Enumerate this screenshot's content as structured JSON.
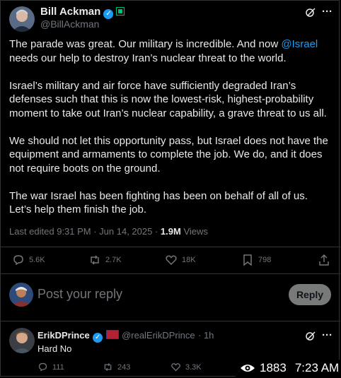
{
  "post": {
    "author_name": "Bill Ackman",
    "author_handle": "@BillAckman",
    "paragraphs": [
      {
        "before": "The parade was great. Our military is incredible. And now ",
        "mention": "@Israel",
        "after": " needs our help to destroy Iran’s nuclear threat to the world."
      },
      {
        "text": "Israel’s military and air force have sufficiently degraded Iran’s defenses such that this is now the lowest-risk, highest-probability moment to take out Iran’s nuclear capability, a grave threat to us all."
      },
      {
        "text": "We should not let this opportunity pass, but Israel does not have the equipment and armaments to complete the job. We do, and it does not require boots on the ground."
      },
      {
        "text": "The war Israel has been fighting has been on behalf of all of us. Let’s help them finish the job."
      }
    ],
    "meta_edited": "Last edited 9:31 PM · Jun 14, 2025 · ",
    "views_count": "1.9M",
    "views_label": " Views",
    "actions": {
      "replies": "5.6K",
      "reposts": "2.7K",
      "likes": "18K",
      "bookmarks": "798"
    }
  },
  "composer": {
    "placeholder": "Post your reply",
    "reply_button": "Reply"
  },
  "reply": {
    "author_name": "ErikDPrince",
    "author_handle": "@realErikDPrince",
    "time": "· 1h",
    "text": "Hard No",
    "actions": {
      "replies": "111",
      "reposts": "243",
      "likes": "3.3K"
    }
  },
  "overlay": {
    "views": "1883",
    "time": "7:23 AM"
  },
  "colors": {
    "accent": "#1d9bf0",
    "background": "#000000",
    "muted": "#71767b",
    "text": "#e7e9ea"
  },
  "icons": [
    "grok-icon",
    "more-icon",
    "reply-icon",
    "repost-icon",
    "like-icon",
    "bookmark-icon",
    "share-icon",
    "eye-icon"
  ]
}
